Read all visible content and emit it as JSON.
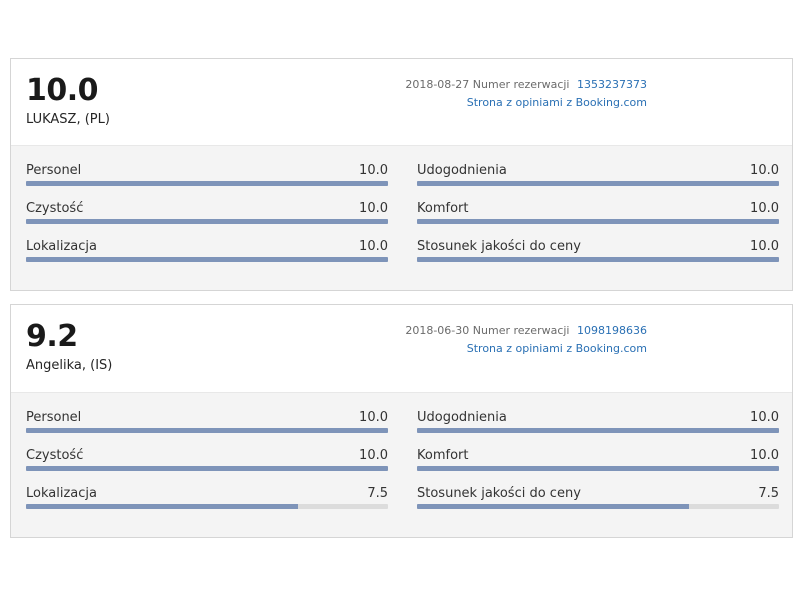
{
  "reviews": [
    {
      "score": "10.0",
      "reviewer": "LUKASZ, (PL)",
      "date": "2018-08-27",
      "reservation_label": "Numer rezerwacji",
      "reservation_number": "1353237373",
      "source_link": "Strona z opiniami z Booking.com",
      "categories": [
        {
          "label": "Personel",
          "value": "10.0",
          "fraction": 1.0
        },
        {
          "label": "Udogodnienia",
          "value": "10.0",
          "fraction": 1.0
        },
        {
          "label": "Czystość",
          "value": "10.0",
          "fraction": 1.0
        },
        {
          "label": "Komfort",
          "value": "10.0",
          "fraction": 1.0
        },
        {
          "label": "Lokalizacja",
          "value": "10.0",
          "fraction": 1.0
        },
        {
          "label": "Stosunek jakości do ceny",
          "value": "10.0",
          "fraction": 1.0
        }
      ]
    },
    {
      "score": "9.2",
      "reviewer": "Angelika, (IS)",
      "date": "2018-06-30",
      "reservation_label": "Numer rezerwacji",
      "reservation_number": "1098198636",
      "source_link": "Strona z opiniami z Booking.com",
      "categories": [
        {
          "label": "Personel",
          "value": "10.0",
          "fraction": 1.0
        },
        {
          "label": "Udogodnienia",
          "value": "10.0",
          "fraction": 1.0
        },
        {
          "label": "Czystość",
          "value": "10.0",
          "fraction": 1.0
        },
        {
          "label": "Komfort",
          "value": "10.0",
          "fraction": 1.0
        },
        {
          "label": "Lokalizacja",
          "value": "7.5",
          "fraction": 0.75
        },
        {
          "label": "Stosunek jakości do ceny",
          "value": "7.5",
          "fraction": 0.75
        }
      ]
    }
  ],
  "colors": {
    "bar_fill": "#7e94b9",
    "bar_track": "#dcdcdc",
    "link": "#2a70b4"
  }
}
